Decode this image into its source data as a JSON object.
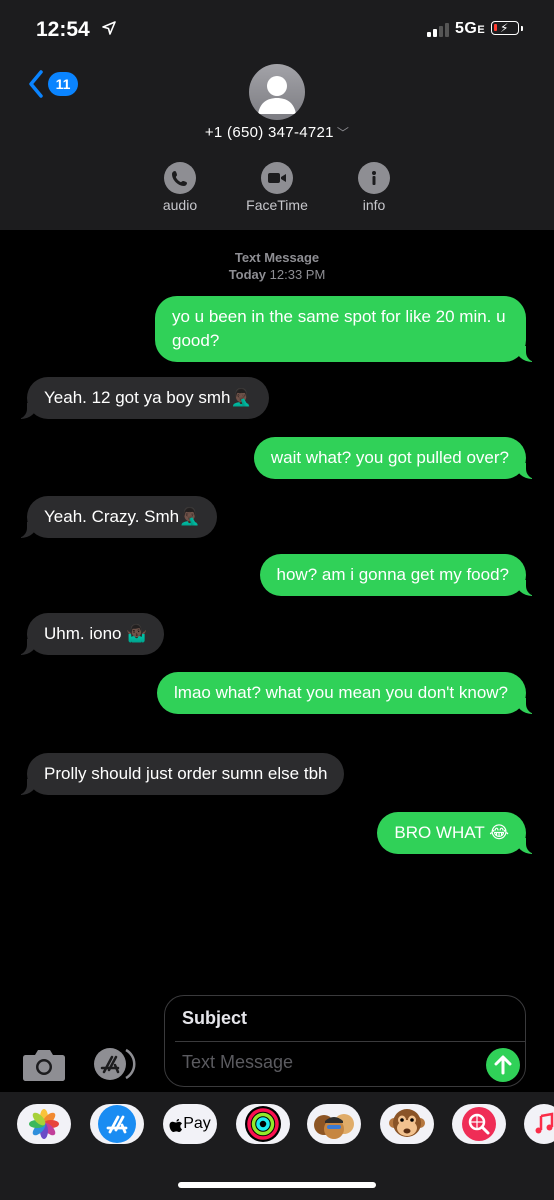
{
  "status_bar": {
    "time": "12:54",
    "network": "5G",
    "network_suffix": "E"
  },
  "header": {
    "back_count": "11",
    "contact_number": "+1 (650) 347-4721",
    "actions": [
      {
        "label": "audio",
        "icon": "phone-icon"
      },
      {
        "label": "FaceTime",
        "icon": "video-camera-icon"
      },
      {
        "label": "info",
        "icon": "info-icon"
      }
    ]
  },
  "thread": {
    "service_label": "Text Message",
    "day_label": "Today",
    "time_label": "12:33 PM",
    "messages": [
      {
        "direction": "outgoing",
        "text": "yo u been in the same spot for like 20 min. u good?"
      },
      {
        "direction": "incoming",
        "text": "Yeah. 12 got ya boy smh🤦🏿‍♂️"
      },
      {
        "direction": "outgoing",
        "text": "wait what? you got pulled over?"
      },
      {
        "direction": "incoming",
        "text": "Yeah. Crazy. Smh🤦🏿‍♂️"
      },
      {
        "direction": "outgoing",
        "text": "how? am i gonna get my food?"
      },
      {
        "direction": "incoming",
        "text": "Uhm. iono 🤷🏿‍♂️"
      },
      {
        "direction": "outgoing",
        "text": "lmao what? what you mean you don't know?"
      },
      {
        "direction": "incoming",
        "text": "Prolly should just order sumn else tbh"
      },
      {
        "direction": "outgoing",
        "text": "BRO WHAT 😂"
      }
    ]
  },
  "composer": {
    "subject_placeholder": "Subject",
    "message_placeholder": "Text Message"
  },
  "app_drawer": {
    "apps": [
      {
        "name": "photos-app-icon"
      },
      {
        "name": "app-store-app-icon"
      },
      {
        "name": "apple-pay-app-icon",
        "label": "Pay"
      },
      {
        "name": "activity-app-icon"
      },
      {
        "name": "memoji-app-icon"
      },
      {
        "name": "animoji-app-icon"
      },
      {
        "name": "web-search-app-icon"
      },
      {
        "name": "music-app-icon"
      }
    ]
  },
  "colors": {
    "outgoing_bubble": "#30d158",
    "incoming_bubble": "#2c2c2e",
    "accent": "#0a84ff"
  }
}
